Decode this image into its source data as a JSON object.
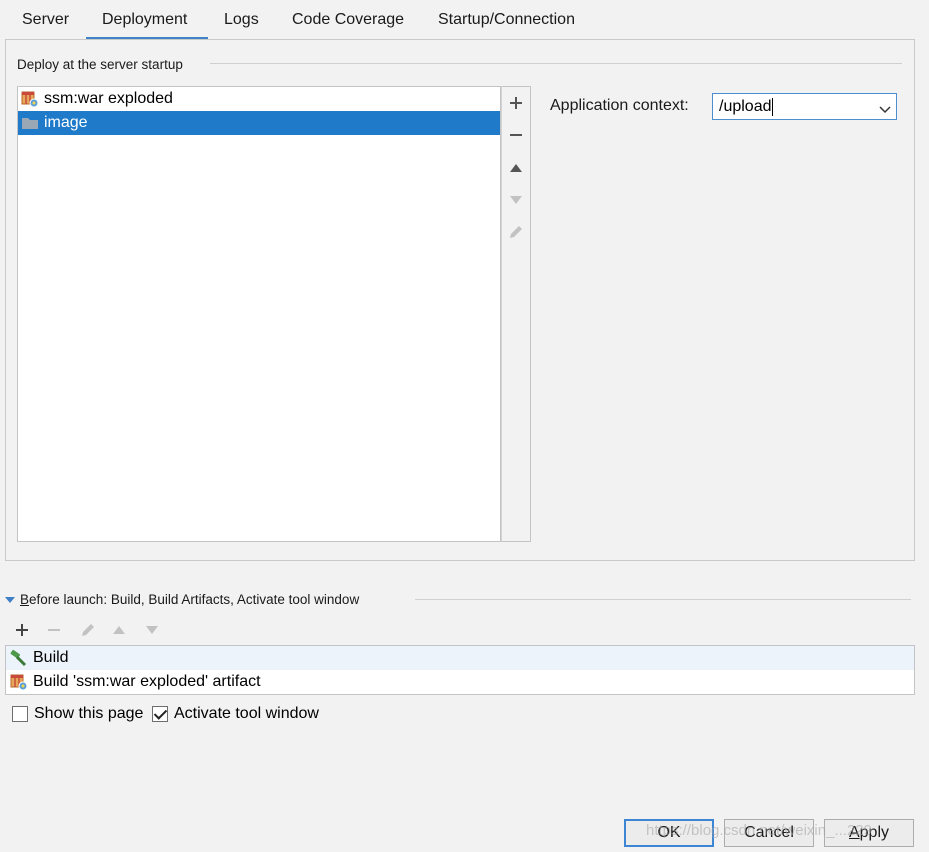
{
  "tabs": [
    {
      "label": "Server"
    },
    {
      "label": "Deployment"
    },
    {
      "label": "Logs"
    },
    {
      "label": "Code Coverage"
    },
    {
      "label": "Startup/Connection"
    }
  ],
  "active_tab": "Deployment",
  "deploy": {
    "group_title": "Deploy at the server startup",
    "artifacts": [
      {
        "label": "ssm:war exploded",
        "icon": "war-artifact-icon"
      },
      {
        "label": "image",
        "icon": "folder-icon",
        "selected": true
      }
    ],
    "toolbar": [
      "add-icon",
      "remove-icon",
      "move-up-icon",
      "move-down-icon",
      "edit-icon"
    ],
    "context_label": "Application context:",
    "context_value": "/upload"
  },
  "before_launch": {
    "title_prefix": "B",
    "title_rest": "efore launch: Build, Build Artifacts, Activate tool window",
    "toolbar": [
      "add-icon",
      "remove-icon",
      "edit-icon",
      "move-up-icon",
      "move-down-icon"
    ],
    "tasks": [
      {
        "label": "Build",
        "icon": "hammer-icon"
      },
      {
        "label": "Build 'ssm:war exploded' artifact",
        "icon": "war-artifact-icon"
      }
    ]
  },
  "options": {
    "show_page": {
      "label": "Show this page",
      "checked": false
    },
    "activate_tool": {
      "label": "Activate tool window",
      "checked": true
    }
  },
  "buttons": {
    "ok": "OK",
    "cancel": "Cancel",
    "apply_prefix": "A",
    "apply_rest": "pply"
  },
  "watermark": "https://blog.csdn.net/weixin_...229",
  "colors": {
    "accent": "#1f7bc9",
    "tab_underline": "#4083c9"
  }
}
